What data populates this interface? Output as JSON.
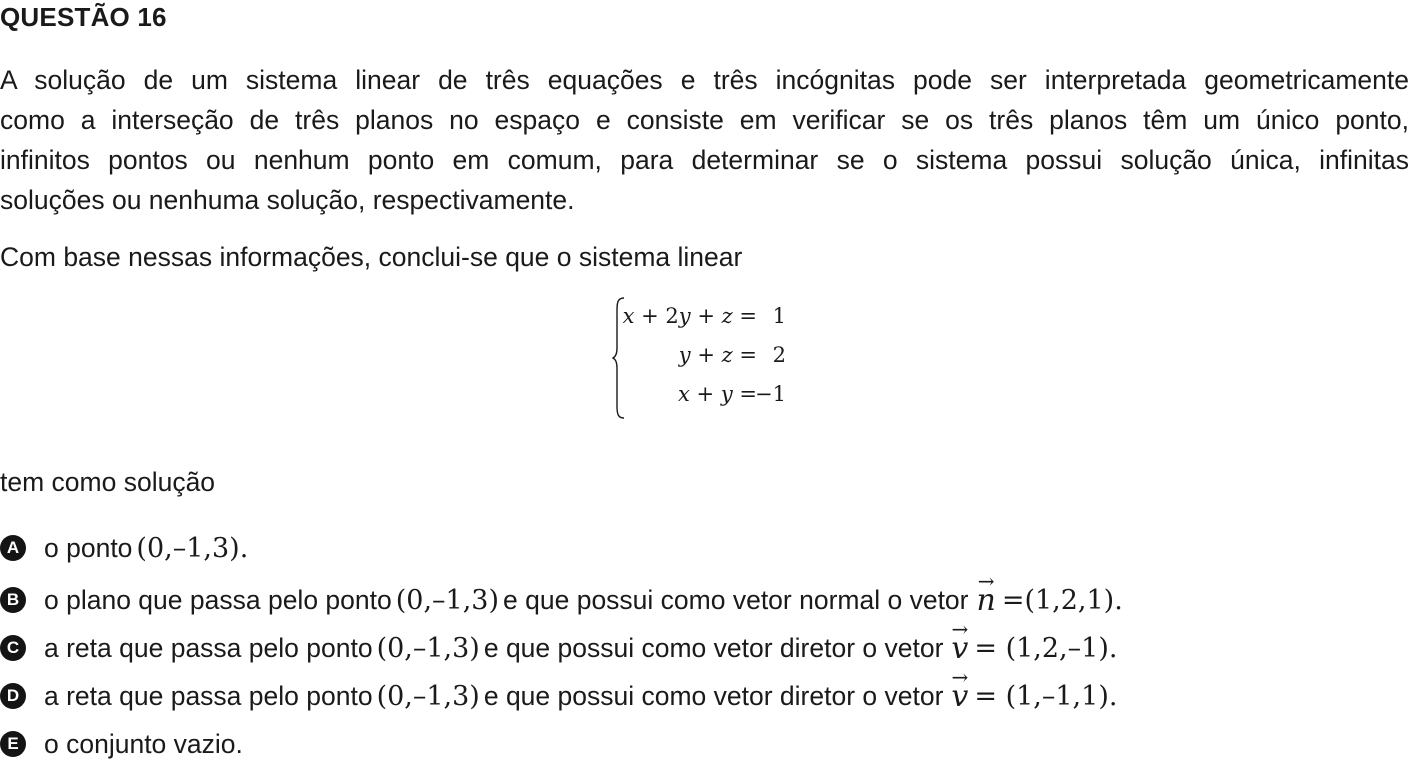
{
  "question": {
    "title": "QUESTÃO 16",
    "paragraph1": [
      "A solução de um sistema linear de três equações e três incógnitas pode ser interpretada geometricamente",
      "como a interseção de três planos no espaço e consiste em verificar se os três planos têm um único ponto,",
      "infinitos pontos ou nenhum ponto em comum, para determinar se o sistema possui solução única, infinitas",
      "soluções ou nenhuma solução, respectivamente."
    ],
    "paragraph2": "Com base nessas informações, conclui-se que o sistema linear",
    "system": [
      {
        "lhs": "x + 2y + z =",
        "rhs": "1"
      },
      {
        "lhs": "y + z =",
        "rhs": "2"
      },
      {
        "lhs": "x + y =",
        "rhs": "−1"
      }
    ],
    "paragraph3": "tem como solução",
    "options": [
      {
        "letter": "A",
        "text_before": "o ponto",
        "math1": "(0,–1,3).",
        "text_middle": "",
        "vector": "",
        "math2": ""
      },
      {
        "letter": "B",
        "text_before": "o plano que passa pelo ponto",
        "math1": "(0,–1,3)",
        "text_middle": "e que possui como vetor normal o vetor",
        "vector": "n",
        "math2": "=(1,2,1)."
      },
      {
        "letter": "C",
        "text_before": "a reta que passa pelo ponto",
        "math1": "(0,–1,3)",
        "text_middle": "e que possui como vetor diretor o vetor",
        "vector": "v",
        "math2": "= (1,2,–1)."
      },
      {
        "letter": "D",
        "text_before": "a reta que passa pelo ponto",
        "math1": "(0,–1,3)",
        "text_middle": "e que possui como vetor diretor o vetor",
        "vector": "v",
        "math2": "= (1,–1,1)."
      },
      {
        "letter": "E",
        "text_before": "o conjunto vazio.",
        "math1": "",
        "text_middle": "",
        "vector": "",
        "math2": ""
      }
    ]
  }
}
